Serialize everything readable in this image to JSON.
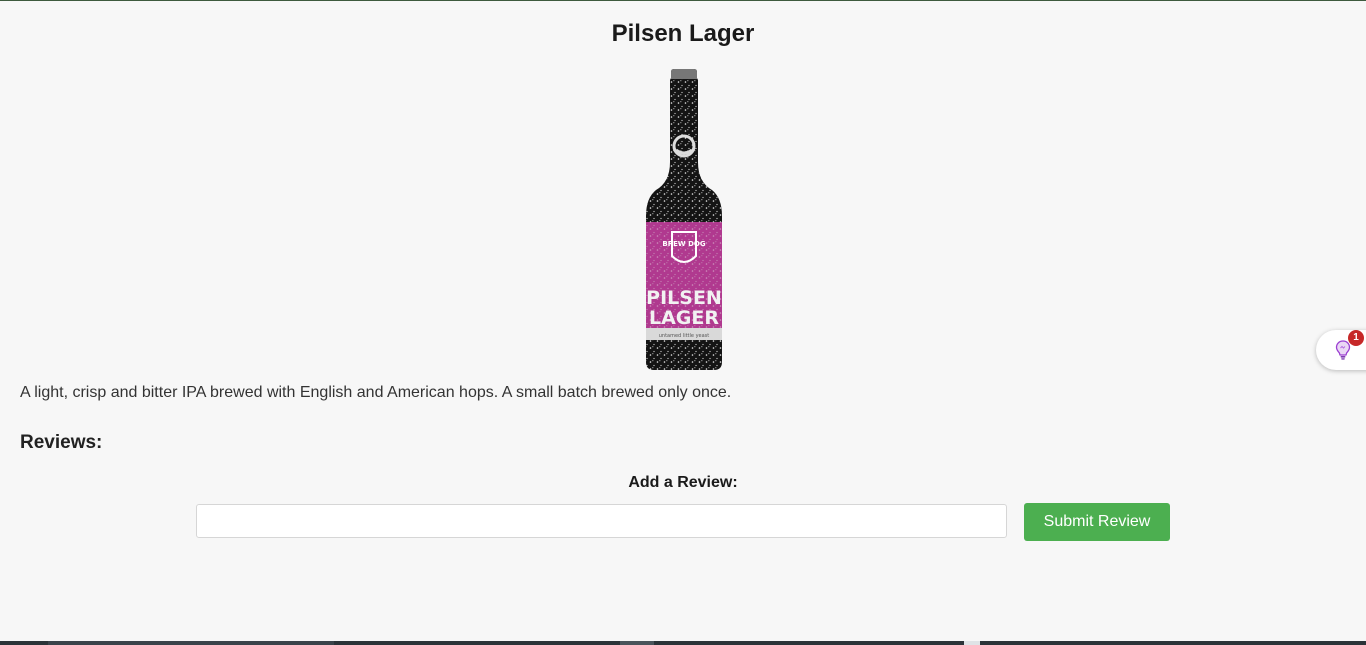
{
  "product": {
    "title": "Pilsen Lager",
    "description": "A light, crisp and bitter IPA brewed with English and American hops. A small batch brewed only once.",
    "image": {
      "label_brand": "BREW DOG",
      "label_line1": "PILSEN",
      "label_line2": "LAGER",
      "label_sub": "untamed little yeast",
      "label_color": "#b0398f",
      "bottle_color": "#141414"
    }
  },
  "reviews": {
    "heading": "Reviews:",
    "add_label": "Add a Review:",
    "input_value": "",
    "submit_label": "Submit Review",
    "button_color": "#4caf50"
  },
  "widget": {
    "icon": "lightbulb-icon",
    "badge_count": "1"
  }
}
